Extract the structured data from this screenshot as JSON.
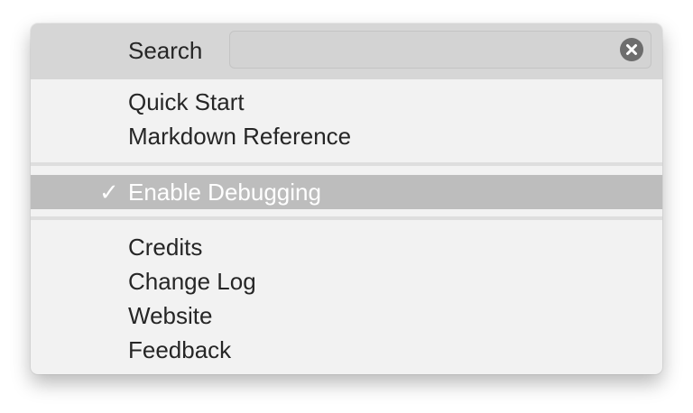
{
  "search": {
    "label": "Search",
    "value": "",
    "placeholder": ""
  },
  "menu": {
    "help_items": [
      "Quick Start",
      "Markdown Reference"
    ],
    "debug_item": {
      "label": "Enable Debugging",
      "checked": true,
      "check_mark": "✓"
    },
    "info_items": [
      "Credits",
      "Change Log",
      "Website",
      "Feedback"
    ]
  },
  "colors": {
    "menu_background": "#f2f2f2",
    "search_row_background": "#d6d6d6",
    "highlight": "#bdbdbd",
    "text": "#262626"
  }
}
